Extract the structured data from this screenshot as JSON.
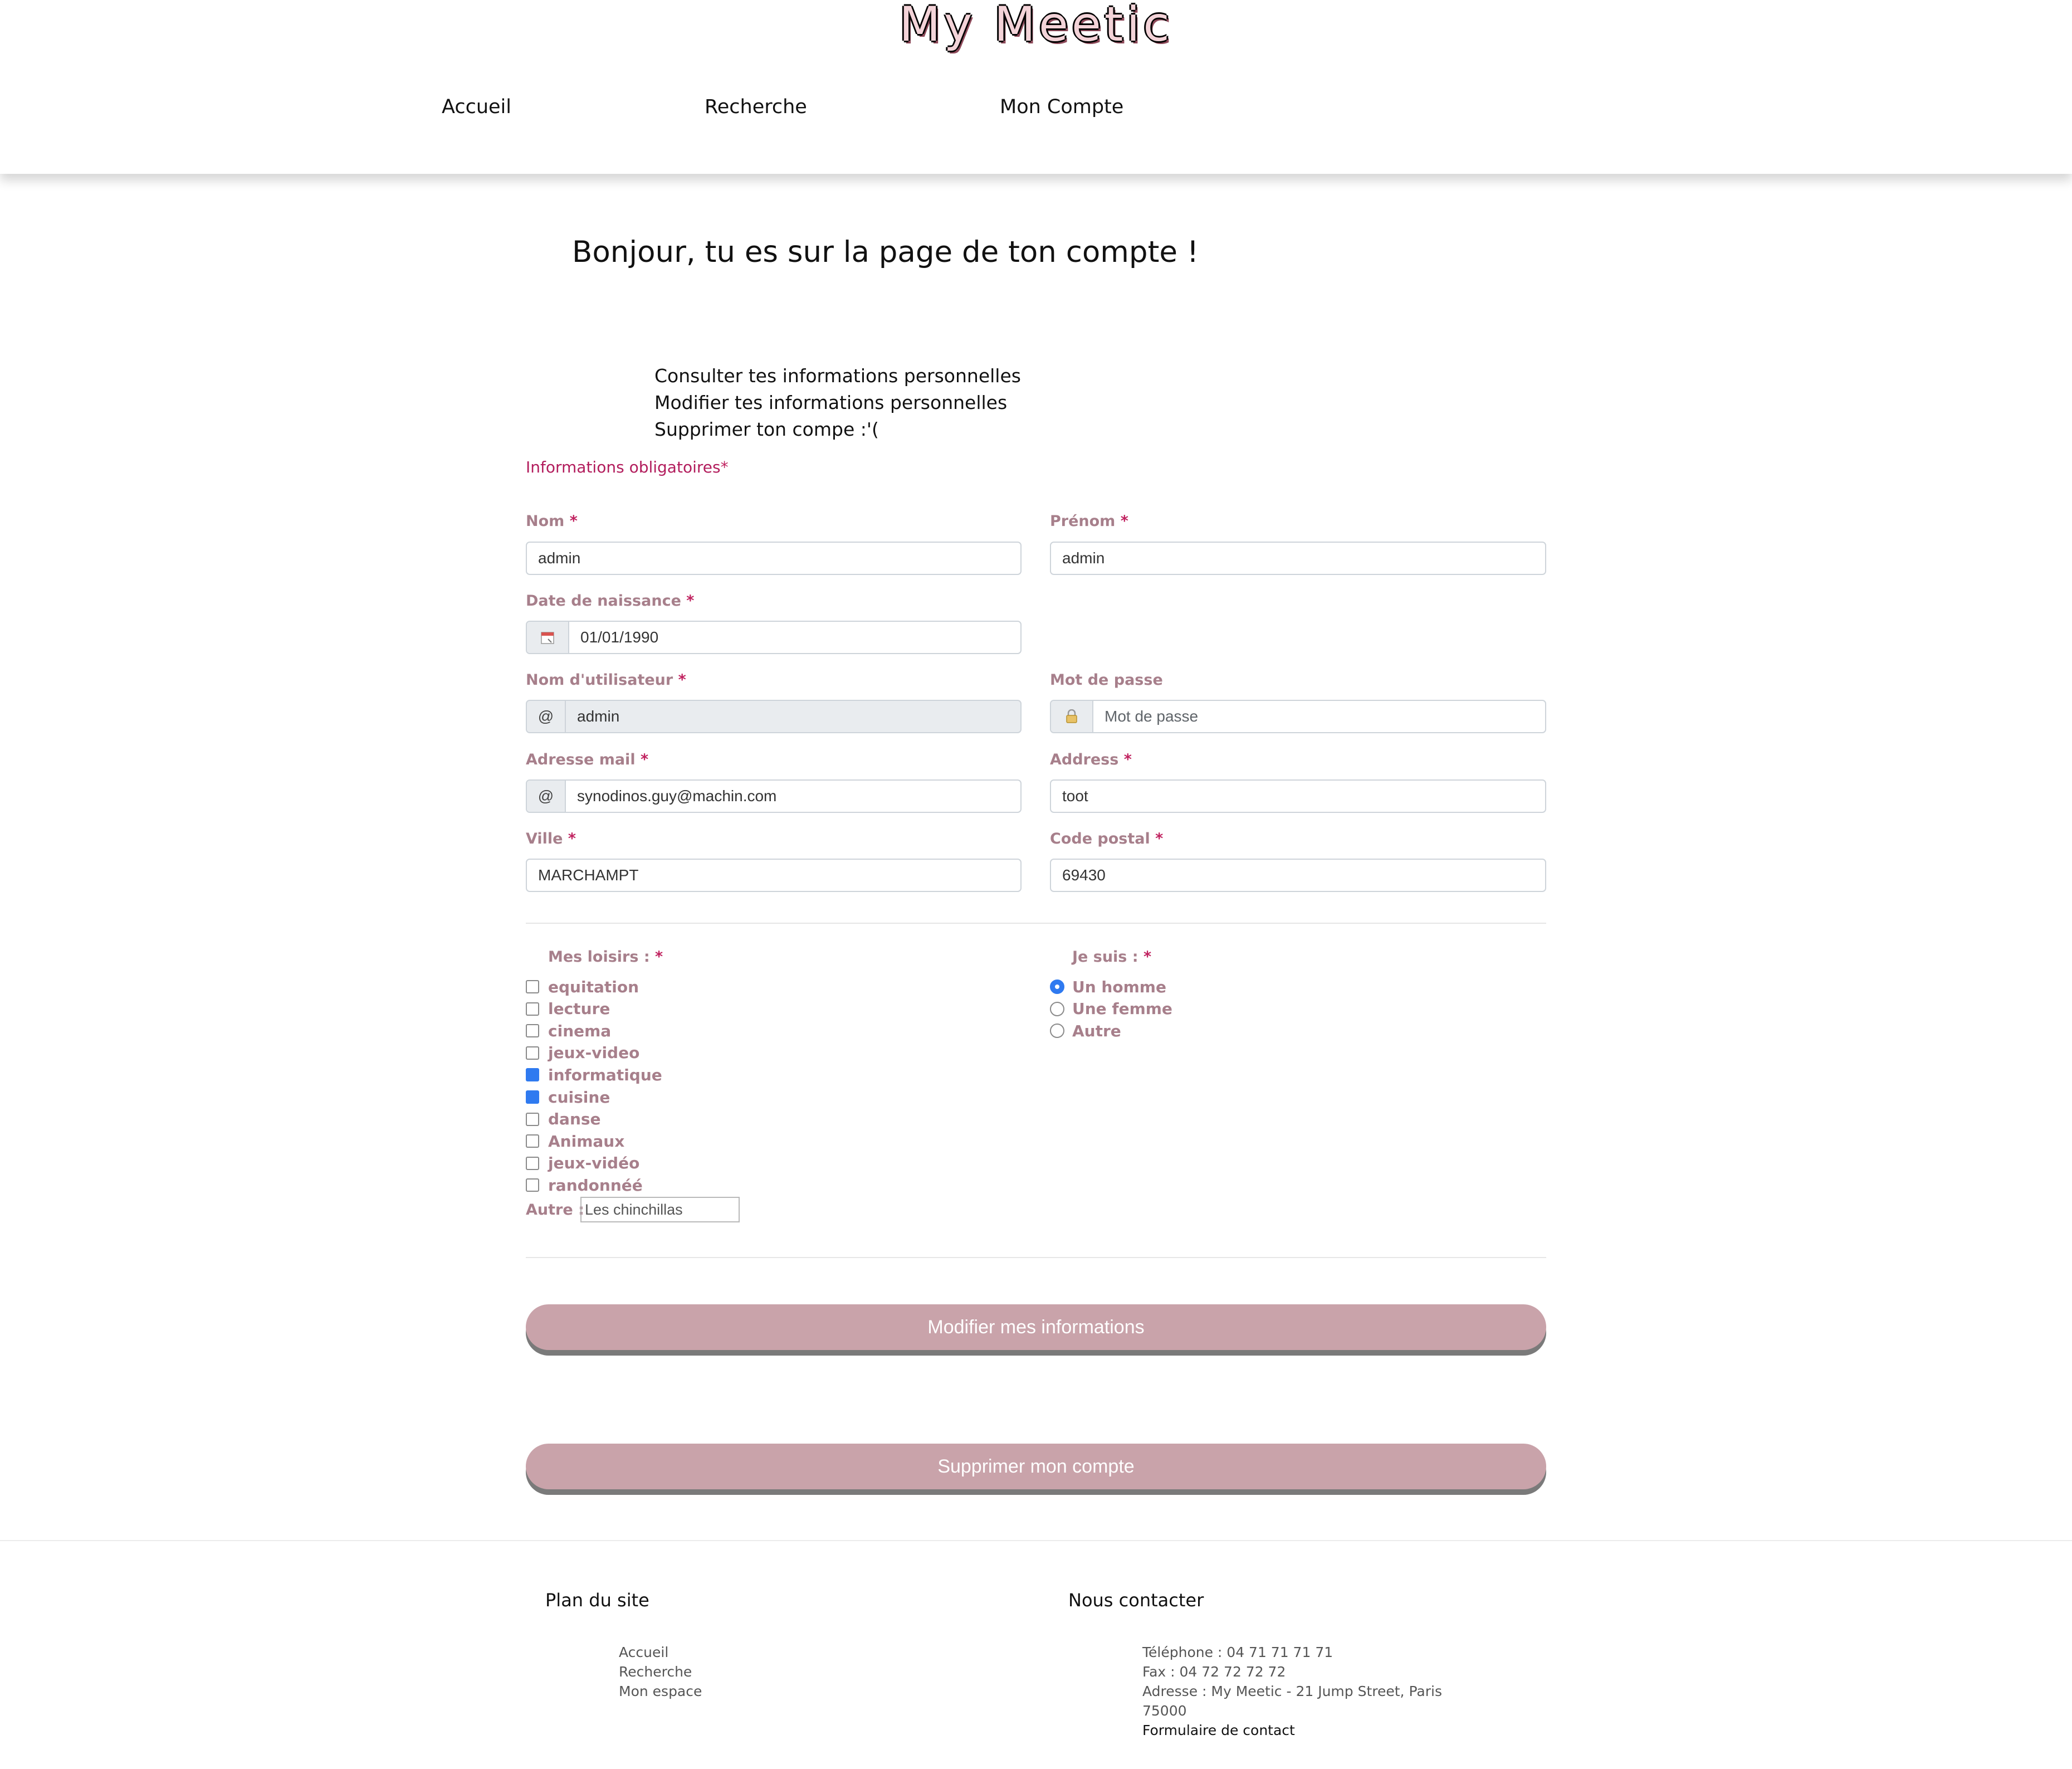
{
  "header": {
    "logo": "My Meetic",
    "nav": [
      "Accueil",
      "Recherche",
      "Mon Compte"
    ]
  },
  "greeting": "Bonjour, tu es sur la page de ton compte !",
  "account_menu": [
    "Consulter tes informations personnelles",
    "Modifier tes informations personnelles",
    "Supprimer ton compe :'("
  ],
  "form": {
    "required_note": "Informations obligatoires",
    "required_mark": "*",
    "fields": {
      "nom": {
        "label": "Nom",
        "value": "admin"
      },
      "prenom": {
        "label": "Prénom",
        "value": "admin"
      },
      "birthdate": {
        "label": "Date de naissance",
        "value": "01/01/1990",
        "icon": "calendar-icon"
      },
      "username": {
        "label": "Nom d'utilisateur",
        "value": "admin",
        "addon": "@"
      },
      "password": {
        "label": "Mot de passe",
        "placeholder": "Mot de passe",
        "icon": "lock-icon"
      },
      "email": {
        "label": "Adresse mail",
        "value": "synodinos.guy@machin.com",
        "addon": "@"
      },
      "address": {
        "label": "Address",
        "value": "toot"
      },
      "ville": {
        "label": "Ville",
        "value": "MARCHAMPT"
      },
      "code_postal": {
        "label": "Code postal",
        "value": "69430"
      }
    },
    "hobbies": {
      "label": "Mes loisirs :",
      "items": [
        {
          "label": "equitation",
          "checked": false
        },
        {
          "label": "lecture",
          "checked": false
        },
        {
          "label": "cinema",
          "checked": false
        },
        {
          "label": "jeux-video",
          "checked": false
        },
        {
          "label": "informatique",
          "checked": true
        },
        {
          "label": "cuisine",
          "checked": true
        },
        {
          "label": "danse",
          "checked": false
        },
        {
          "label": "Animaux",
          "checked": false
        },
        {
          "label": "jeux-vidéo",
          "checked": false
        },
        {
          "label": "randonnéé",
          "checked": false
        }
      ],
      "other_label": "Autre :",
      "other_value": "Les chinchillas"
    },
    "gender": {
      "label": "Je suis :",
      "options": [
        {
          "label": "Un homme",
          "selected": true
        },
        {
          "label": "Une femme",
          "selected": false
        },
        {
          "label": "Autre",
          "selected": false
        }
      ]
    },
    "submit_label": "Modifier mes informations",
    "delete_label": "Supprimer mon compte"
  },
  "footer": {
    "sitemap_title": "Plan du site",
    "sitemap_links": [
      "Accueil",
      "Recherche",
      "Mon espace"
    ],
    "contact_title": "Nous contacter",
    "phone": "Téléphone : 04 71 71 71 71",
    "fax": "Fax : 04 72 72 72 72",
    "address_line1": "Adresse : My Meetic - 21 Jump Street, Paris",
    "address_line2": "75000",
    "contact_form": "Formulaire de contact"
  },
  "colors": {
    "label": "#a77f8b",
    "required": "#c0225f",
    "button": "#c9a3aa",
    "checked": "#2f7af0"
  }
}
